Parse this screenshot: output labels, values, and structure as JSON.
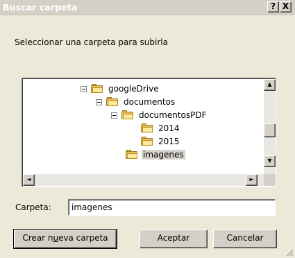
{
  "window": {
    "title": "Buscar carpeta",
    "help_label": "?",
    "close_label": "X"
  },
  "instruction": "Seleccionar una carpeta para subirla",
  "tree": {
    "items": [
      {
        "label": "googleDrive",
        "expanded": true
      },
      {
        "label": "documentos",
        "expanded": true
      },
      {
        "label": "documentosPDF",
        "expanded": true
      },
      {
        "label": "2014"
      },
      {
        "label": "2015"
      },
      {
        "label": "imagenes",
        "selected": true
      }
    ]
  },
  "scroll": {
    "up_arrow": "▲",
    "down_arrow": "▼",
    "left_arrow": "◄",
    "right_arrow": "►"
  },
  "folder_field": {
    "label": "Carpeta:",
    "value": "imagenes"
  },
  "buttons": {
    "new_folder_pre": "Crear n",
    "new_folder_key": "u",
    "new_folder_post": "eva carpeta",
    "ok": "Aceptar",
    "cancel": "Cancelar"
  },
  "colors": {
    "dialog_bg": "#ece9d8",
    "selection": "#d6d3cc",
    "folder_yellow": "#e8c35a"
  }
}
